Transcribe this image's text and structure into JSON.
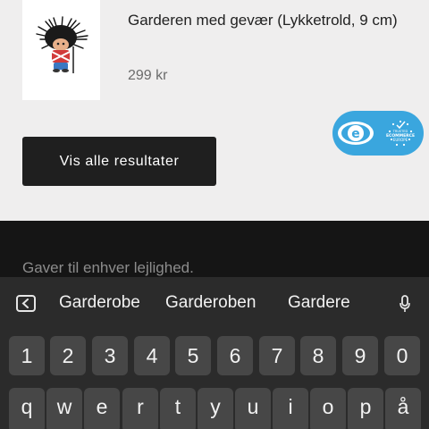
{
  "product": {
    "name": "Garderen med gevær (Lykketrold, 9 cm)",
    "price": "299 kr"
  },
  "search": {
    "show_all_label": "Vis alle resultater"
  },
  "badge": {
    "icon": "e-mark-icon",
    "label_top": "TRUSTED",
    "label_mid": "ECOMMERCE",
    "label_bottom": "EUROPE",
    "color": "#3aa6de"
  },
  "footer": {
    "tagline": "Gaver til enhver lejlighed."
  },
  "keyboard": {
    "suggestions": [
      "Garderobe",
      "Garderoben",
      "Gardere"
    ],
    "number_row": [
      "1",
      "2",
      "3",
      "4",
      "5",
      "6",
      "7",
      "8",
      "9",
      "0"
    ],
    "letter_row": [
      "q",
      "w",
      "e",
      "r",
      "t",
      "y",
      "u",
      "i",
      "o",
      "p",
      "å"
    ]
  },
  "colors": {
    "page_bg": "#efeeee",
    "button_bg": "#1f1f1f",
    "footer_bg": "#151515",
    "keyboard_bg": "#2b2b2b",
    "key_bg": "#474747"
  }
}
